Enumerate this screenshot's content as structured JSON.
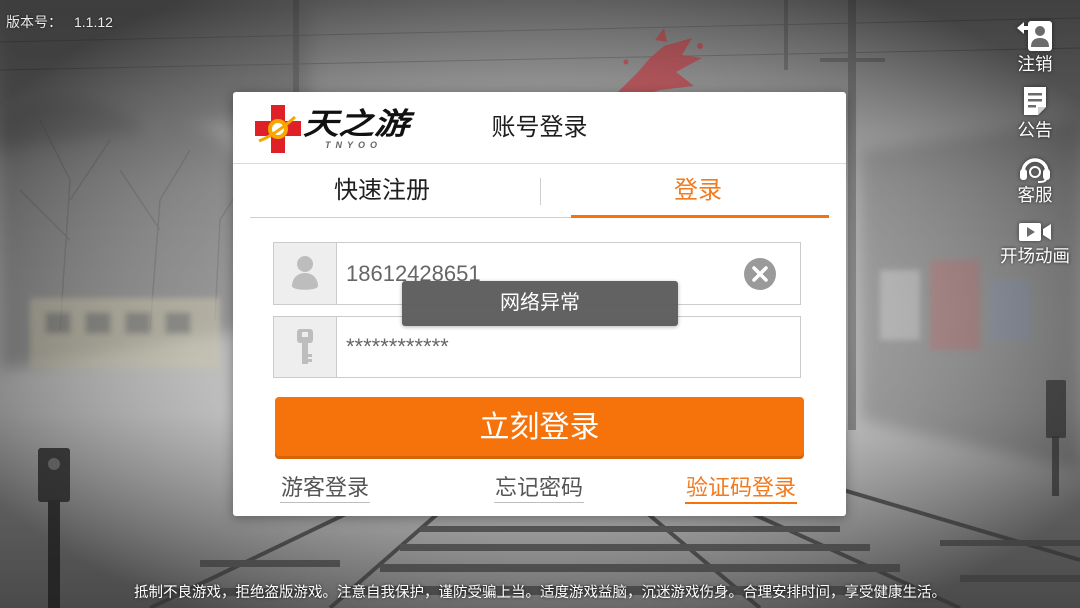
{
  "version": {
    "label": "版本号：",
    "value": "1.1.12"
  },
  "side_menu": [
    {
      "icon": "logout-icon",
      "label": "注销"
    },
    {
      "icon": "announcement-icon",
      "label": "公告"
    },
    {
      "icon": "headset-icon",
      "label": "客服"
    },
    {
      "icon": "video-camera-icon",
      "label": "开场动画"
    }
  ],
  "dialog": {
    "logo": {
      "text": "天之游",
      "subtext": "TNYOO",
      "icon": "logo-emblem-icon"
    },
    "title": "账号登录",
    "tabs": [
      {
        "label": "快速注册",
        "active": false
      },
      {
        "label": "登录",
        "active": true
      }
    ],
    "username": {
      "icon": "user-icon",
      "value": "18612428651",
      "clear_icon": "clear-icon"
    },
    "password": {
      "icon": "key-icon",
      "value": "************"
    },
    "toast": "网络异常",
    "login_button": "立刻登录",
    "links": {
      "guest_login": "游客登录",
      "forgot_password": "忘记密码",
      "sms_code_login": "验证码登录"
    }
  },
  "footer_notice": "抵制不良游戏，拒绝盗版游戏。注意自我保护，谨防受骗上当。适度游戏益脑，沉迷游戏伤身。合理安排时间，享受健康生活。",
  "colors": {
    "accent": "#f5730a",
    "accent_text": "#f27a1f",
    "toast_bg": "#5c5c5c"
  }
}
